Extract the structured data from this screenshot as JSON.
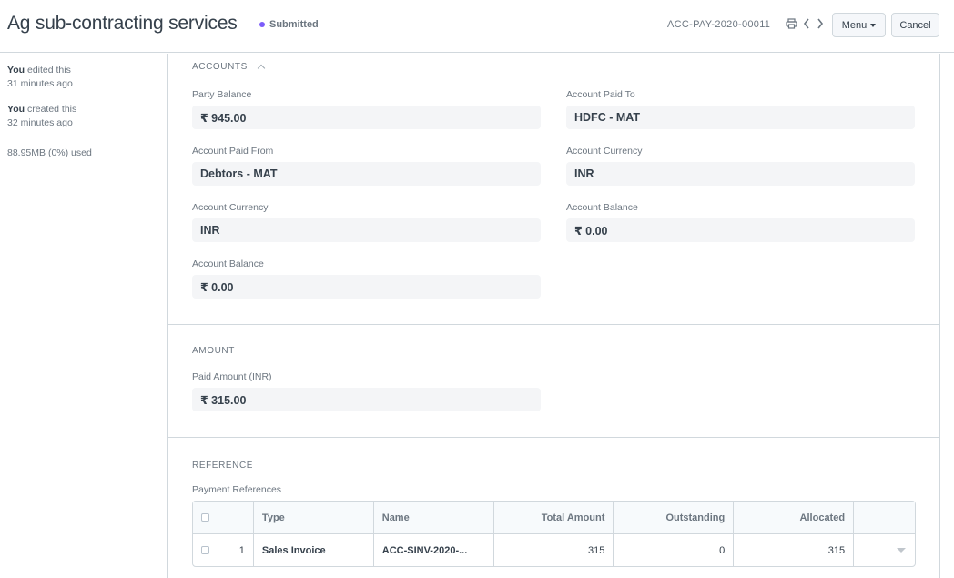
{
  "header": {
    "title": "Ag sub-contracting services",
    "status": "Submitted",
    "status_color": "#7c5cfa",
    "doc_name": "ACC-PAY-2020-00011",
    "icons": [
      "printer-icon",
      "chevron-left-icon",
      "chevron-right-icon"
    ],
    "menu_label": "Menu",
    "cancel_label": "Cancel"
  },
  "sidebar": {
    "edited": {
      "who": "You",
      "action": " edited this",
      "when": "31 minutes ago"
    },
    "created": {
      "who": "You",
      "action": " created this",
      "when": "32 minutes ago"
    },
    "usage": "88.95MB (0%) used"
  },
  "accounts": {
    "heading": "ACCOUNTS",
    "party_balance": {
      "label": "Party Balance",
      "value": "₹ 945.00"
    },
    "account_paid_to": {
      "label": "Account Paid To",
      "value": "HDFC - MAT"
    },
    "account_paid_from": {
      "label": "Account Paid From",
      "value": "Debtors - MAT"
    },
    "account_currency_to": {
      "label": "Account Currency",
      "value": "INR"
    },
    "account_currency_from": {
      "label": "Account Currency",
      "value": "INR"
    },
    "account_balance_to": {
      "label": "Account Balance",
      "value": "₹ 0.00"
    },
    "account_balance_from": {
      "label": "Account Balance",
      "value": "₹ 0.00"
    }
  },
  "amount": {
    "heading": "AMOUNT",
    "paid_amount": {
      "label": "Paid Amount (INR)",
      "value": "₹ 315.00"
    }
  },
  "reference": {
    "heading": "REFERENCE",
    "table_label": "Payment References",
    "columns": [
      "Type",
      "Name",
      "Total Amount",
      "Outstanding",
      "Allocated"
    ],
    "rows": [
      {
        "idx": "1",
        "type": "Sales Invoice",
        "name": "ACC-SINV-2020-...",
        "total": "315",
        "outstanding": "0",
        "allocated": "315"
      }
    ]
  }
}
